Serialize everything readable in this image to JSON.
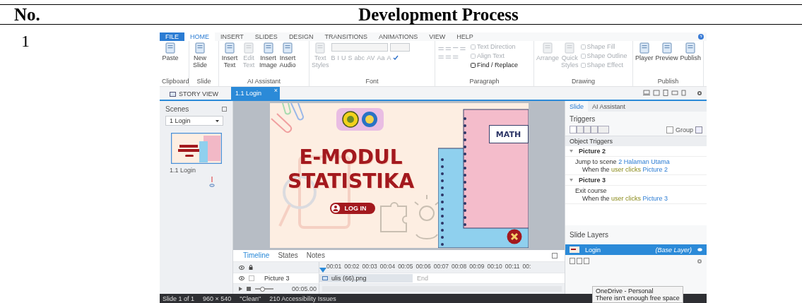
{
  "table": {
    "headers": [
      "No.",
      "Development Process"
    ],
    "row_number": "1"
  },
  "menu_tabs": [
    {
      "label": "FILE",
      "kind": "file",
      "selected": false
    },
    {
      "label": "HOME",
      "kind": "tab",
      "selected": true
    },
    {
      "label": "INSERT",
      "kind": "tab",
      "selected": false
    },
    {
      "label": "SLIDES",
      "kind": "tab",
      "selected": false
    },
    {
      "label": "DESIGN",
      "kind": "tab",
      "selected": false
    },
    {
      "label": "TRANSITIONS",
      "kind": "tab",
      "selected": false
    },
    {
      "label": "ANIMATIONS",
      "kind": "tab",
      "selected": false
    },
    {
      "label": "VIEW",
      "kind": "tab",
      "selected": false
    },
    {
      "label": "HELP",
      "kind": "tab",
      "selected": false
    }
  ],
  "ribbon_groups": [
    {
      "label": "Clipboard",
      "kind": "buttons",
      "columns": [
        [
          {
            "label": "Paste",
            "kind": "large",
            "disabled": false
          }
        ]
      ]
    },
    {
      "label": "Slide",
      "kind": "buttons",
      "columns": [
        [
          {
            "label": "New Slide",
            "kind": "large",
            "disabled": false
          }
        ]
      ]
    },
    {
      "label": "AI Assistant",
      "kind": "buttons",
      "columns": [
        [
          {
            "label": "Insert Text",
            "kind": "large",
            "disabled": false
          }
        ],
        [
          {
            "label": "Edit Text",
            "kind": "large",
            "disabled": true
          }
        ],
        [
          {
            "label": "Insert Image",
            "kind": "large",
            "disabled": false
          }
        ],
        [
          {
            "label": "Insert Audio",
            "kind": "large",
            "disabled": false
          }
        ]
      ]
    },
    {
      "label": "Font",
      "kind": "font",
      "columns": [
        [
          {
            "label": "Text Styles",
            "kind": "large",
            "disabled": true
          }
        ]
      ],
      "format_buttons": [
        "B",
        "I",
        "U",
        "S",
        "abc",
        "AV",
        "Aa",
        "A"
      ]
    },
    {
      "label": "Paragraph",
      "kind": "paragraph",
      "columns": [
        [
          {
            "label": "Text Direction",
            "kind": "small",
            "disabled": true
          },
          {
            "label": "Align Text",
            "kind": "small",
            "disabled": true
          },
          {
            "label": "Find / Replace",
            "kind": "small",
            "disabled": false
          }
        ]
      ]
    },
    {
      "label": "Drawing",
      "kind": "buttons",
      "columns": [
        [
          {
            "label": "Arrange",
            "kind": "large",
            "disabled": true
          }
        ],
        [
          {
            "label": "Quick Styles",
            "kind": "large",
            "disabled": true
          }
        ],
        [
          {
            "label": "Shape Fill",
            "kind": "small",
            "disabled": true
          },
          {
            "label": "Shape Outline",
            "kind": "small",
            "disabled": true
          },
          {
            "label": "Shape Effect",
            "kind": "small",
            "disabled": true
          }
        ]
      ]
    },
    {
      "label": "Publish",
      "kind": "buttons",
      "columns": [
        [
          {
            "label": "Player",
            "kind": "large",
            "disabled": false
          }
        ],
        [
          {
            "label": "Preview",
            "kind": "large",
            "disabled": false
          }
        ],
        [
          {
            "label": "Publish",
            "kind": "large",
            "disabled": false
          }
        ]
      ]
    }
  ],
  "doc_tabs": [
    {
      "label": "STORY VIEW",
      "selected": false
    },
    {
      "label": "1.1 Login",
      "selected": true
    }
  ],
  "doc_close": "×",
  "scenes": {
    "title": "Scenes",
    "dropdown": "1 Login",
    "slide_label": "1.1 Login"
  },
  "slide": {
    "title_lines": [
      "E-MODUL",
      "STATISTIKA"
    ],
    "login_button": "LOG IN",
    "notebook_label": "MATH"
  },
  "timeline": {
    "tabs": [
      {
        "label": "Timeline",
        "selected": true
      },
      {
        "label": "States",
        "selected": false
      },
      {
        "label": "Notes",
        "selected": false
      }
    ],
    "ticks": [
      "00:01",
      "00:02",
      "00:03",
      "00:04",
      "00:05",
      "00:06",
      "00:07",
      "00:08",
      "00:09",
      "00:10",
      "00:11",
      "00:"
    ],
    "layer": {
      "name": "Picture 3",
      "locked": false,
      "file": "ulis (66).png",
      "end": "End"
    },
    "duration": "00:05.00",
    "zoom": {
      "level": 0.4
    }
  },
  "properties": {
    "tabs": [
      {
        "label": "Slide",
        "selected": true
      },
      {
        "label": "AI Assistant",
        "selected": false
      }
    ],
    "triggers_title": "Triggers",
    "group_label": "Group",
    "group_checked": false,
    "object_triggers_title": "Object Triggers",
    "triggers": [
      {
        "object": "Picture 2",
        "expanded": true,
        "action": "Jump to scene",
        "target": "2 Halaman Utama",
        "when": "When the",
        "event": "user clicks",
        "subject": "Picture 2"
      },
      {
        "object": "Picture 3",
        "expanded": true,
        "action": "Exit course",
        "when": "When the",
        "event": "user clicks",
        "subject": "Picture 3"
      }
    ],
    "layers_title": "Slide Layers",
    "layers": [
      {
        "name": "Login",
        "note": "(Base Layer)",
        "selected": true
      }
    ]
  },
  "status": [
    "Slide 1 of 1",
    "960 × 540",
    "\"Clean\"",
    "210 Accessibility Issues"
  ],
  "tooltip": {
    "title": "OneDrive - Personal",
    "text": "There isn't enough free space"
  }
}
